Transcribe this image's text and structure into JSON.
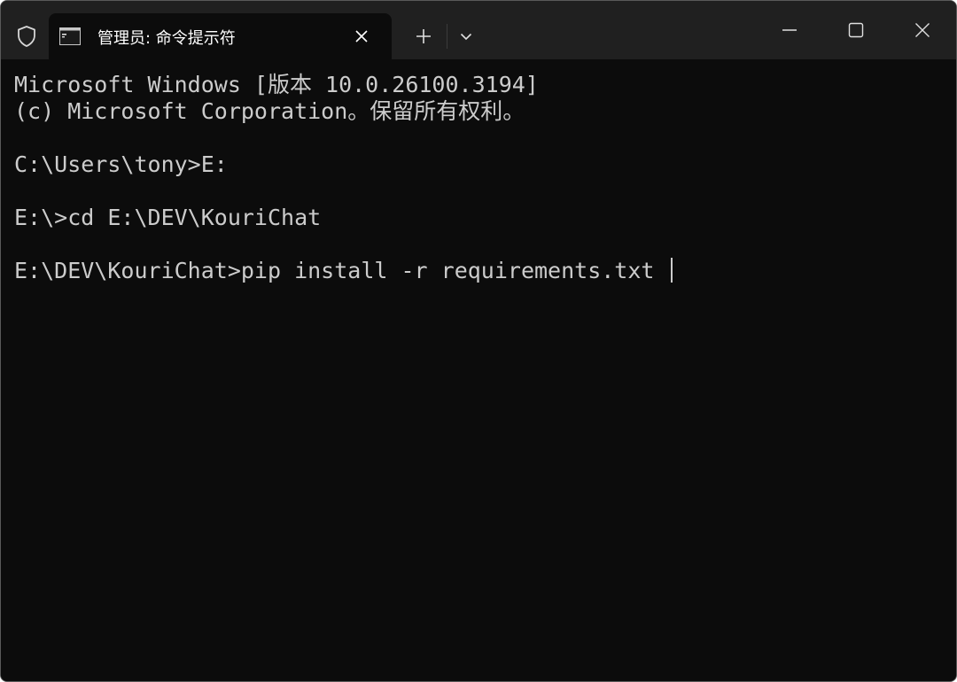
{
  "titlebar": {
    "tab_title": "管理员: 命令提示符",
    "tab_icon": "cmd-icon",
    "icons": {
      "shield": "shield-icon",
      "tab_close": "close-icon",
      "new_tab": "plus-icon",
      "dropdown": "chevron-down-icon",
      "minimize": "minimize-icon",
      "maximize": "maximize-icon",
      "close": "close-icon"
    }
  },
  "terminal": {
    "lines": [
      "Microsoft Windows [版本 10.0.26100.3194]",
      "(c) Microsoft Corporation。保留所有权利。",
      "",
      "C:\\Users\\tony>E:",
      "",
      "E:\\>cd E:\\DEV\\KouriChat",
      "",
      "E:\\DEV\\KouriChat>pip install -r requirements.txt"
    ]
  },
  "colors": {
    "terminal_background": "#0c0c0c",
    "titlebar_background": "#202020",
    "text": "#cccccc"
  }
}
